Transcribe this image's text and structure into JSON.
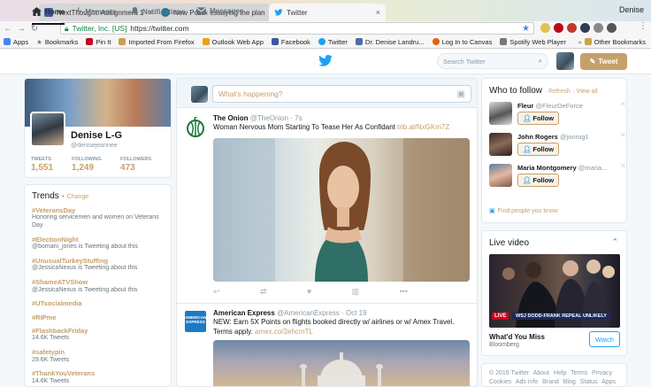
{
  "browser": {
    "tabs": [
      {
        "title": "NextThought: Assignment 1"
      },
      {
        "title": "New Post ‹ essaying the plan"
      },
      {
        "title": "Twitter"
      }
    ],
    "user": "Denise",
    "url_org": "Twitter, Inc. [US]",
    "url": "https://twitter.com",
    "bookmarks": [
      "Apps",
      "Bookmarks",
      "Pin It",
      "Imported From Firefox",
      "Outlook Web App",
      "Facebook",
      "Twitter",
      "Dr. Denise Landru...",
      "Log In to Canvas",
      "Spotify Web Player",
      "Other Bookmarks"
    ],
    "bookmarks_more": "»"
  },
  "nav": {
    "home": "Home",
    "moments": "Moments",
    "notifications": "Notifications",
    "messages": "Messages",
    "search_placeholder": "Search Twitter",
    "tweet_button": "Tweet"
  },
  "profile": {
    "name": "Denise L-G",
    "handle": "@denisejeannee",
    "stats": [
      {
        "label": "TWEETS",
        "value": "1,551"
      },
      {
        "label": "FOLLOWING",
        "value": "1,249"
      },
      {
        "label": "FOLLOWERS",
        "value": "473"
      }
    ]
  },
  "trends": {
    "title": "Trends",
    "change": "Change",
    "items": [
      {
        "tag": "#VeteransDay",
        "desc": "Honoring servicemen and women on Veterans Day"
      },
      {
        "tag": "#ElectionNight",
        "desc": "@bomani_jones is Tweeting about this"
      },
      {
        "tag": "#UnusualTurkeyStuffing",
        "desc": "@JessicaNexus is Tweeting about this"
      },
      {
        "tag": "#ShameATVShow",
        "desc": "@JessicaNexus is Tweeting about this"
      },
      {
        "tag": "#UTsocialmedia",
        "desc": ""
      },
      {
        "tag": "#RIPme",
        "desc": ""
      },
      {
        "tag": "#FlashbackFriday",
        "desc": "14.6K Tweets"
      },
      {
        "tag": "#safetypin",
        "desc": "29.6K Tweets"
      },
      {
        "tag": "#ThankYouVeterans",
        "desc": "14.6K Tweets"
      }
    ]
  },
  "compose": {
    "placeholder": "What's happening?"
  },
  "tweets": [
    {
      "name": "The Onion",
      "handle": "@TheOnion",
      "time": "· 7s",
      "text": "Woman Nervous Mom Starting To Tease Her As Confidant ",
      "link": "trib.al/NxGKm7Z"
    },
    {
      "name": "American Express",
      "handle": "@AmericanExpress",
      "time": "· Oct 19",
      "text": "NEW: Earn 5X Points on flights booked directly w/ airlines or w/ Amex Travel. Terms apply. ",
      "link": "amex.co/2ehcmTL",
      "logo_text": "AMERICAN EXPRESS"
    }
  ],
  "who_to_follow": {
    "title": "Who to follow",
    "refresh": "· Refresh",
    "view_all": "· View all",
    "follow_label": "Follow",
    "users": [
      {
        "name": "Fleur",
        "handle": "@FleurDeForce"
      },
      {
        "name": "John Rogers",
        "handle": "@jonrog1"
      },
      {
        "name": "Maria Montgomery",
        "handle": "@maria..."
      }
    ],
    "find_people": "Find people you know"
  },
  "live_video": {
    "title": "Live video",
    "badge": "LIVE",
    "lower_third": "WSJ DODD-FRANK REPEAL UNLIKELY",
    "video_title": "What'd You Miss",
    "source": "Bloomberg",
    "watch": "Watch"
  },
  "footer": {
    "links": [
      "© 2016 Twitter",
      "About",
      "Help",
      "Terms",
      "Privacy",
      "Cookies",
      "Ads info",
      "Brand",
      "Blog",
      "Status",
      "Apps"
    ]
  },
  "colors": {
    "accent": "#c6a06a",
    "twitter_blue": "#1da1f2"
  }
}
